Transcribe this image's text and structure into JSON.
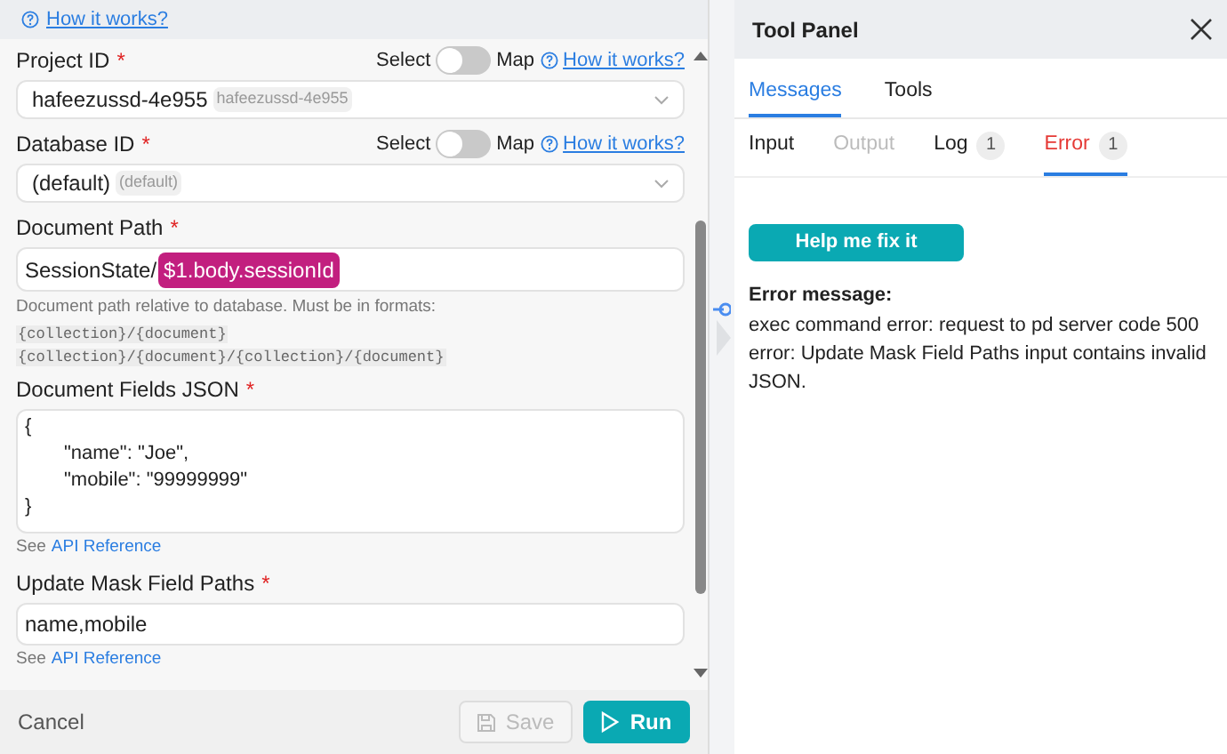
{
  "top_link": "How it works?",
  "fields": [
    {
      "kind": "select",
      "label": "Project ID",
      "required": "*",
      "toggle": {
        "left": "Select",
        "right": "Map",
        "on": false,
        "link": "How it works?"
      },
      "value": "hafeezussd-4e955",
      "badge": "hafeezussd-4e955"
    },
    {
      "kind": "select",
      "label": "Database ID",
      "required": "*",
      "toggle": {
        "left": "Select",
        "right": "Map",
        "on": false,
        "link": "How it works?"
      },
      "value": "(default)",
      "badge": "(default)"
    },
    {
      "kind": "template",
      "label": "Document Path",
      "required": "*",
      "value": "SessionState/",
      "token": "$1.body.sessionId",
      "help": "Document path relative to database. Must be in formats:",
      "code_lines": [
        "{collection}/{document}",
        "{collection}/{document}/{collection}/{document}"
      ]
    },
    {
      "kind": "textarea",
      "label": "Document Fields JSON",
      "required": "*",
      "lines": [
        "{",
        "\"name\": \"Joe\",",
        "\"mobile\": \"99999999\"",
        "}"
      ],
      "reference": {
        "prefix": "See",
        "link": "API Reference"
      }
    },
    {
      "kind": "text",
      "label": "Update Mask Field Paths",
      "required": "*",
      "value": "name,mobile",
      "reference": {
        "prefix": "See",
        "link": "API Reference"
      }
    }
  ],
  "footer": {
    "cancel": "Cancel",
    "save": {
      "label": "Save",
      "disabled": true
    },
    "run": "Run"
  },
  "tool_panel": {
    "title": "Tool Panel",
    "tabs": [
      {
        "label": "Messages",
        "selected": true
      },
      {
        "label": "Tools",
        "selected": false
      }
    ],
    "subtabs": [
      {
        "label": "Input",
        "selected": false,
        "disabled": false,
        "error": false
      },
      {
        "label": "Output",
        "selected": false,
        "disabled": true,
        "error": false
      },
      {
        "label": "Log",
        "count": "1",
        "selected": false,
        "disabled": false,
        "error": false
      },
      {
        "label": "Error",
        "count": "1",
        "selected": true,
        "disabled": false,
        "error": true
      }
    ],
    "help_button": "Help me fix it",
    "error_title": "Error message:",
    "error_lines": [
      "exec command error: request to pd server code 500",
      "error: Update Mask Field Paths input contains invalid",
      "JSON."
    ]
  }
}
